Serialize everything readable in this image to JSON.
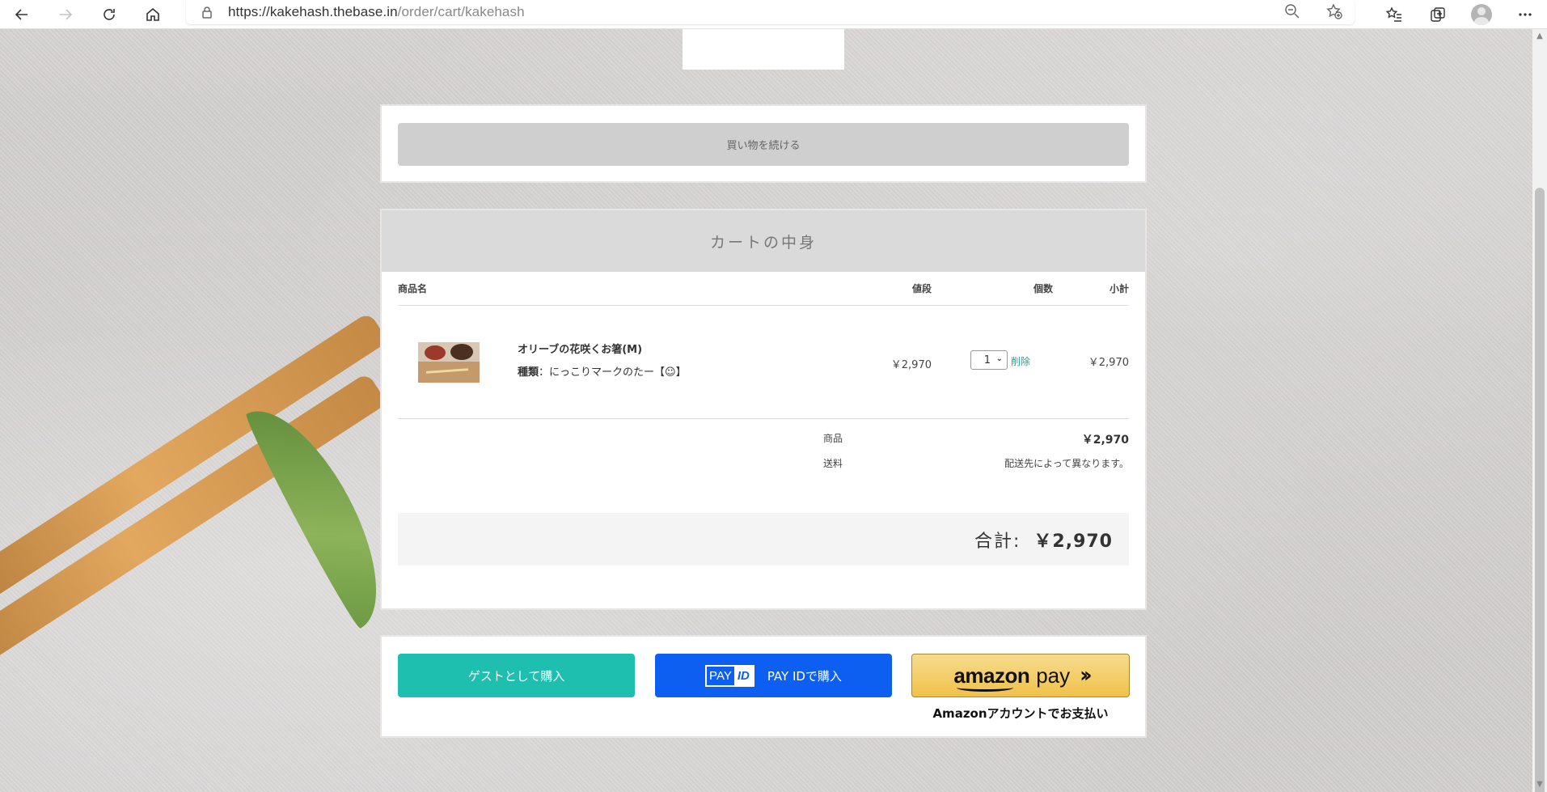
{
  "browser": {
    "url_host": "https://kakehash.thebase.in",
    "url_path": "/order/cart/kakehash"
  },
  "continue": {
    "label": "買い物を続ける"
  },
  "cart": {
    "title": "カートの中身",
    "columns": {
      "name": "商品名",
      "price": "値段",
      "qty": "個数",
      "subtotal": "小計"
    },
    "items": [
      {
        "name": "オリーブの花咲くお箸(M)",
        "variant_label": "種類",
        "variant_value": "にっこりマークのたー【☺】",
        "price": "￥2,970",
        "qty": "1",
        "delete_label": "削除",
        "subtotal": "￥2,970"
      }
    ],
    "summary": {
      "products_label": "商品",
      "products_value": "￥2,970",
      "shipping_label": "送料",
      "shipping_value": "配送先によって異なります。"
    },
    "total_label": "合計:",
    "total_value": "￥2,970"
  },
  "payment": {
    "guest_label": "ゲストとして購入",
    "payid_logo_pay": "PAY",
    "payid_logo_id": "ID",
    "payid_label": "PAY IDで購入",
    "amazon_word": "amazon",
    "amazon_pay": "pay",
    "amazon_caption": "Amazonアカウントでお支払い"
  },
  "colors": {
    "guest": "#1ebfae",
    "payid": "#0c5ff0",
    "amazon": "#f0c14b",
    "delete_link": "#1fa69a"
  }
}
